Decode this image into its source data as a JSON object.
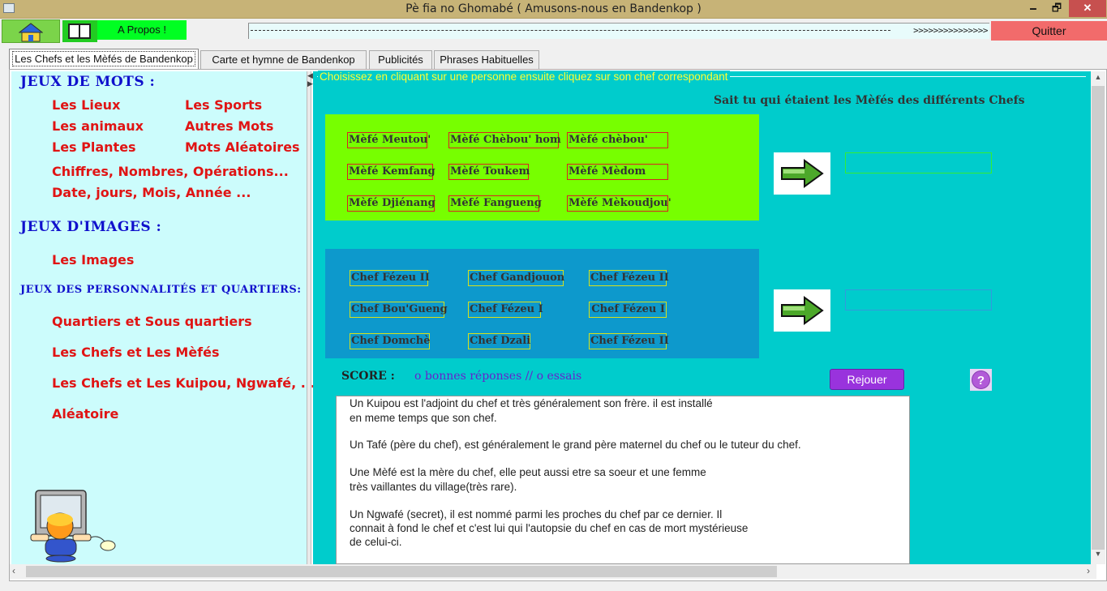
{
  "window": {
    "title": "Pè fia no Ghomabé ( Amusons-nous en Bandenkop )",
    "minimize": "🗕",
    "maximize": "🗗",
    "close": "✕"
  },
  "toolbar": {
    "about_label": "A Propos !",
    "progress_arrows": ">>>>>>>>>>>>>>>",
    "quit_label": "Quitter"
  },
  "tabs": [
    {
      "label": "Les Chefs et les Mèfés de Bandenkop",
      "active": true
    },
    {
      "label": "Carte et hymne de Bandenkop"
    },
    {
      "label": "Publicités"
    },
    {
      "label": "Phrases Habituelles"
    }
  ],
  "sidebar": {
    "words_heading": "JEUX DE MOTS :",
    "words_links": [
      "Les Lieux",
      "Les Sports",
      "Les animaux",
      "Autres Mots",
      "Les Plantes",
      "Mots Aléatoires",
      "Chiffres, Nombres, Opérations...",
      "Date, jours, Mois, Année ..."
    ],
    "images_heading": "JEUX D'IMAGES :",
    "images_link": "Les Images",
    "people_heading": "JEUX DES  PERSONNALITÉS ET QUARTIERS:",
    "people_links": [
      "Quartiers et Sous quartiers",
      "Les Chefs et Les Mèfés",
      "Les Chefs et Les Kuipou, Ngwafé, ...",
      "Aléatoire"
    ]
  },
  "game": {
    "instruction": "Choisissez en cliquant sur une personne ensuite cliquez sur son chef correspondant",
    "subtitle": "Sait tu qui étaient les Mèfés des différents Chefs",
    "mefes": [
      "Mèfé Meutou'",
      "Mèfé Chèbou' hom",
      "Mèfé chèbou'",
      "Mèfé Kemfang",
      "Mèfé Toukem",
      "Mèfé Mèdom",
      "Mèfé Djiénang",
      "Mèfé Fangueng",
      "Mèfé Mèkoudjou'"
    ],
    "chefs": [
      "Chef Fézeu II",
      "Chef Gandjouon",
      "Chef Fézeu II",
      "Chef Bou'Gueng",
      "Chef Fézeu I",
      "Chef Fézeu I",
      "Chef Domchè",
      "Chef Dzali",
      "Chef Fézeu II"
    ],
    "score_label": "SCORE :",
    "score_value": "o bonnes réponses // o essais",
    "replay_label": "Rejouer",
    "help_label": "?",
    "info_lines": [
      "                          Un Kuipou est l'adjoint du chef et très généralement son frère. il est installé",
      "en meme temps que son chef.",
      "                          Un Tafé (père du chef), est généralement le grand père maternel du chef ou le tuteur du chef.",
      "                          Une Mèfé est la mère du chef, elle peut aussi etre sa soeur et une femme",
      "très vaillantes du village(très rare).",
      "                          Un Ngwafé (secret), il est nommé parmi les proches du chef par ce dernier. Il",
      "connait à fond le chef et c'est lui qui l'autopsie du chef en cas de mort mystérieuse",
      "de celui-ci."
    ]
  },
  "colors": {
    "title_bar": "#c7b377",
    "sidebar_bg": "#ccfcfc",
    "main_bg": "#00cccc",
    "green_panel": "#77ff00",
    "blue_panel": "#0d99cc",
    "link_red": "#e01414",
    "heading_blue": "#1010cc"
  }
}
